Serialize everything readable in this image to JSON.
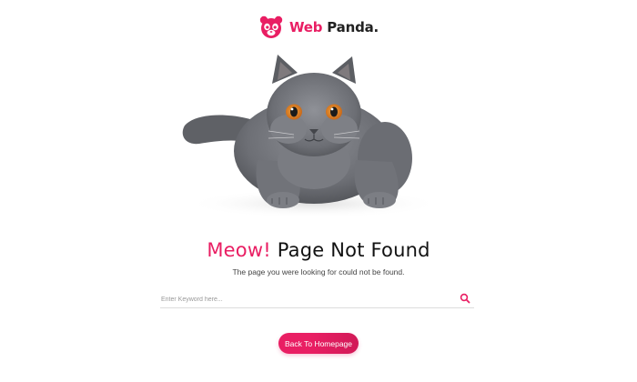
{
  "brand": {
    "name_part1": "Web",
    "name_part2": " Panda",
    "name_dot": ".",
    "accent_color": "#e91e63"
  },
  "hero": {
    "icon": "cat-image"
  },
  "error": {
    "title_accent": "Meow!",
    "title_rest": " Page Not Found",
    "message": "The page you were looking for could not be found."
  },
  "search": {
    "placeholder": "Enter Keyword here...",
    "value": "",
    "icon": "search-icon"
  },
  "actions": {
    "home_label": "Back To Homepage"
  }
}
